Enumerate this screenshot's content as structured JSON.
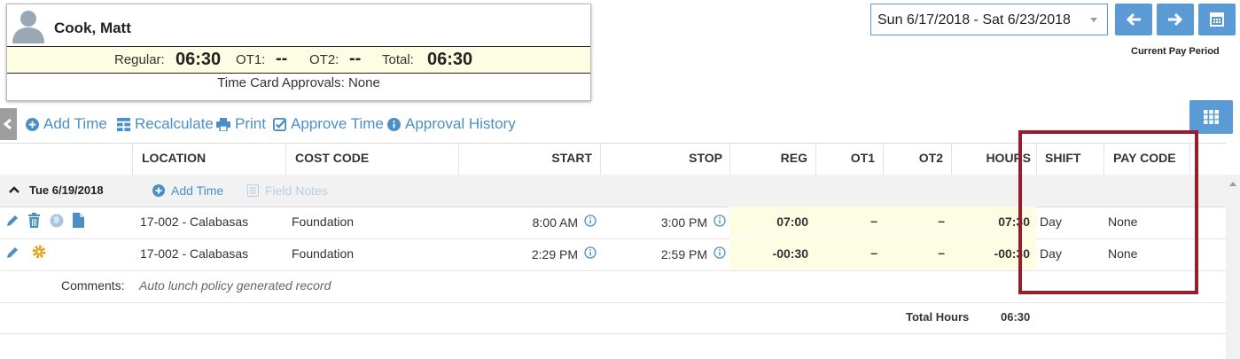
{
  "employee": {
    "name": "Cook, Matt",
    "regular_label": "Regular:",
    "regular_value": "06:30",
    "ot1_label": "OT1:",
    "ot1_value": "--",
    "ot2_label": "OT2:",
    "ot2_value": "--",
    "total_label": "Total:",
    "total_value": "06:30",
    "approvals": "Time Card Approvals: None"
  },
  "period": {
    "range": "Sun 6/17/2018 - Sat 6/23/2018",
    "current_label": "Current Pay Period"
  },
  "toolbar": {
    "add_time": "Add Time",
    "recalculate": "Recalculate",
    "print": "Print",
    "approve_time": "Approve Time",
    "approval_history": "Approval History"
  },
  "columns": {
    "location": "LOCATION",
    "cost_code": "COST CODE",
    "start": "START",
    "stop": "STOP",
    "reg": "REG",
    "ot1": "OT1",
    "ot2": "OT2",
    "hours": "HOURS",
    "shift": "SHIFT",
    "pay_code": "PAY CODE"
  },
  "day_group": {
    "date": "Tue 6/19/2018",
    "add_time": "Add Time",
    "field_notes": "Field Notes"
  },
  "rows": [
    {
      "location": "17-002 - Calabasas",
      "cost_code": "Foundation",
      "start": "8:00 AM",
      "stop": "3:00 PM",
      "reg": "07:00",
      "ot1": "–",
      "ot2": "–",
      "hours": "07:30",
      "shift": "Day",
      "pay_code": "None"
    },
    {
      "location": "17-002 - Calabasas",
      "cost_code": "Foundation",
      "start": "2:29 PM",
      "stop": "2:59 PM",
      "reg": "-00:30",
      "ot1": "–",
      "ot2": "–",
      "hours": "-00:30",
      "shift": "Day",
      "pay_code": "None"
    }
  ],
  "comments": {
    "label": "Comments:",
    "text": "Auto lunch policy generated record"
  },
  "totals": {
    "label": "Total Hours",
    "value": "06:30"
  },
  "colors": {
    "accent": "#5b9bd5",
    "link": "#4a90c7",
    "highlight_box": "#9b1b2a",
    "hours_background": "#fdfde3"
  }
}
